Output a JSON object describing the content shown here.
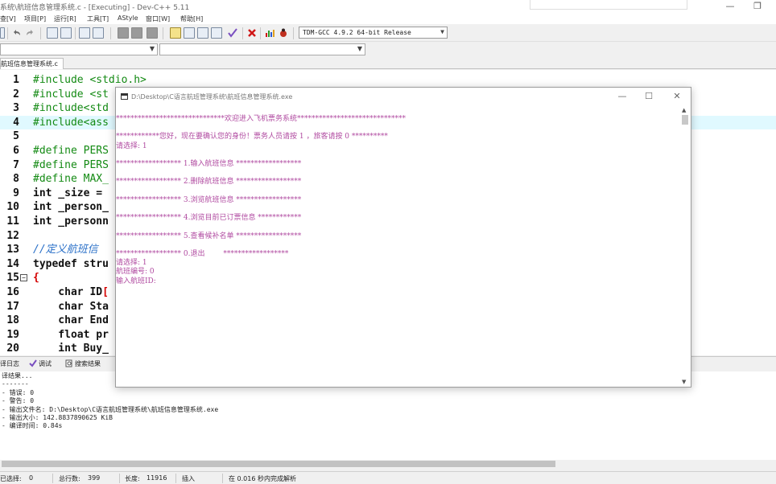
{
  "window": {
    "title": "系统\\航班信息管理系统.c - [Executing] - Dev-C++ 5.11",
    "minimize_glyph": "—",
    "restore_glyph": "❐"
  },
  "menu": [
    "查[V]",
    "项目[P]",
    "运行[R]",
    "工具[T]",
    "AStyle",
    "窗口[W]",
    "帮助[H]"
  ],
  "toolbar": {
    "compiler": "TDM-GCC 4.9.2 64-bit Release"
  },
  "editor": {
    "tab": "航班信息管理系统.c",
    "lines": [
      {
        "n": "1",
        "text": "#include <stdio.h>",
        "style": "pre"
      },
      {
        "n": "2",
        "text": "#include <st",
        "style": "pre"
      },
      {
        "n": "3",
        "text": "#include<std",
        "style": "pre"
      },
      {
        "n": "4",
        "text": "#include<ass",
        "style": "pre",
        "highlight": true
      },
      {
        "n": "5",
        "text": "",
        "style": "plain"
      },
      {
        "n": "6",
        "text": "#define PERS",
        "style": "pre"
      },
      {
        "n": "7",
        "text": "#define PERS",
        "style": "pre"
      },
      {
        "n": "8",
        "text": "#define MAX_",
        "style": "pre"
      },
      {
        "n": "9",
        "text": "int _size =",
        "style": "decl"
      },
      {
        "n": "10",
        "text": "int _person_",
        "style": "decl"
      },
      {
        "n": "11",
        "text": "int _personn",
        "style": "decl"
      },
      {
        "n": "12",
        "text": "",
        "style": "plain"
      },
      {
        "n": "13",
        "text": "//定义航班信",
        "style": "comment"
      },
      {
        "n": "14",
        "text": "typedef stru",
        "style": "typedef"
      },
      {
        "n": "15",
        "text": "{",
        "style": "brace",
        "fold": "−"
      },
      {
        "n": "16",
        "text": "    char ID",
        "style": "member",
        "tail": "["
      },
      {
        "n": "17",
        "text": "    char Sta",
        "style": "member"
      },
      {
        "n": "18",
        "text": "    char End",
        "style": "member"
      },
      {
        "n": "19",
        "text": "    float pr",
        "style": "member"
      },
      {
        "n": "20",
        "text": "    int Buy_",
        "style": "member"
      }
    ]
  },
  "console": {
    "title": "D:\\Desktop\\C语言航班管理系统\\航班信息管理系统.exe",
    "lines": [
      "******************************欢迎进入飞机票务系统******************************",
      "",
      "************您好，现在要确认您的身份！票务人员请按 1 ，旅客请按 0 **********",
      "请选择: 1",
      "",
      "****************** 1.输入航班信息 ******************",
      "",
      "****************** 2.删除航班信息 ******************",
      "",
      "****************** 3.浏览航班信息 ******************",
      "",
      "****************** 4.浏览目前已订票信息 ************",
      "",
      "****************** 5.查看候补名单 ******************",
      "",
      "****************** 0.退出        ******************",
      "请选择: 1",
      "航班编号: 0",
      "输入航班ID:"
    ]
  },
  "bottom_tabs": [
    "译日志",
    "调试",
    "搜索结果"
  ],
  "compile_log": [
    "译结果...",
    "-------",
    "- 错误: 0",
    "- 警告: 0",
    "- 输出文件名: D:\\Desktop\\C语言航班管理系统\\航班信息管理系统.exe",
    "- 输出大小: 142.8837890625 KiB",
    "- 编译时间: 0.84s"
  ],
  "status": {
    "sel_label": "已选择:",
    "sel_value": "0",
    "lines_label": "总行数:",
    "lines_value": "399",
    "len_label": "长度:",
    "len_value": "11916",
    "mode": "插入",
    "parse": "在 0.016 秒内完成解析"
  }
}
